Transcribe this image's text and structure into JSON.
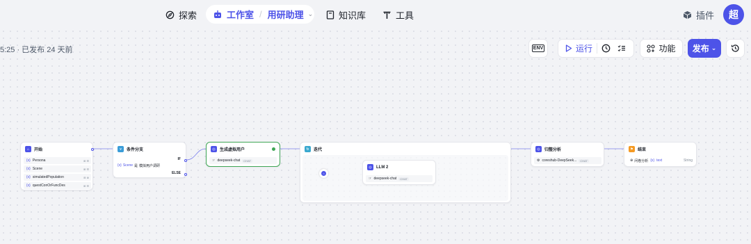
{
  "topnav": {
    "explore": "探索",
    "studio": "工作室",
    "project": "用研助理",
    "knowledge": "知识库",
    "tools": "工具",
    "plugins": "插件",
    "avatar": "超"
  },
  "toolbar": {
    "status": "5:25 · 已发布 24 天前",
    "env": "ENV",
    "run": "运行",
    "features": "功能",
    "publish": "发布"
  },
  "nodes": {
    "start": {
      "title": "开始",
      "fields": [
        {
          "name": "Persona"
        },
        {
          "name": "Scene"
        },
        {
          "name": "simulatedPopulation"
        },
        {
          "name": "questConOrFuncDes"
        }
      ]
    },
    "condition": {
      "title": "条件分支",
      "if_label": "IF",
      "else_label": "ELSE",
      "cond_var": "Scene",
      "cond_op": "是",
      "cond_value": "模拟用户调研"
    },
    "generate": {
      "title": "生成虚拟用户",
      "model": "deepseek-chat",
      "model_tag": "CHAT"
    },
    "iterate": {
      "title": "迭代"
    },
    "llm2": {
      "title": "LLM 2",
      "model": "deepseek-chat",
      "model_tag": "CHAT"
    },
    "summary": {
      "title": "归整分析",
      "model": "coreshub-DeepSeek...",
      "model_tag": "CHAT"
    },
    "end": {
      "title": "结束",
      "output_label": "问卷分析",
      "output_var": "text",
      "output_type": "String"
    }
  },
  "colors": {
    "accent": "#4d53e8",
    "start_icon": "#4d53e8",
    "condition_icon": "#3b9dd8",
    "iterate_icon": "#3aa8cf",
    "end_icon": "#f59a23",
    "success": "#3fa655"
  }
}
